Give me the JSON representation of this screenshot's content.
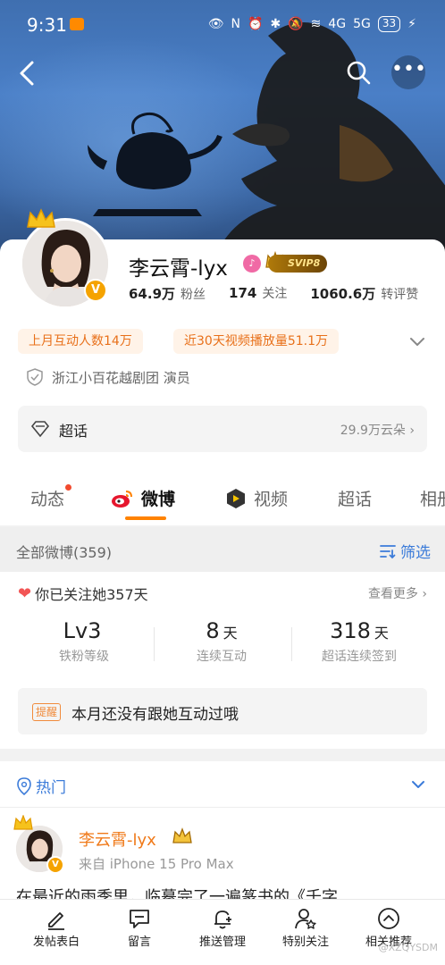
{
  "status_bar": {
    "time": "9:31",
    "network_1": "4G",
    "network_2": "5G",
    "battery": "33"
  },
  "profile": {
    "name": "李云霄-lyx",
    "svip_label": "SVIP8",
    "pink_badge": "♪",
    "v_badge": "V",
    "stats": [
      {
        "value": "64.9万",
        "label": "粉丝"
      },
      {
        "value": "174",
        "label": "关注"
      },
      {
        "value": "1060.6万",
        "label": "转评赞"
      }
    ],
    "tags": [
      "上月互动人数14万",
      "近30天视频播放量51.1万"
    ],
    "verification": "浙江小百花越剧团 演员"
  },
  "chaohua": {
    "label": "超话",
    "count": "29.9万云朵"
  },
  "tabs": [
    {
      "label": "动态"
    },
    {
      "label": "微博"
    },
    {
      "label": "视频"
    },
    {
      "label": "超话"
    },
    {
      "label": "相册"
    }
  ],
  "filter_bar": {
    "all_posts": "全部微博(359)",
    "filter_label": "筛选"
  },
  "fan_section": {
    "following_days": "你已关注她357天",
    "see_more": "查看更多",
    "metrics": [
      {
        "value": "Lv3",
        "unit": "",
        "label": "铁粉等级"
      },
      {
        "value": "8",
        "unit": "天",
        "label": "连续互动"
      },
      {
        "value": "318",
        "unit": "天",
        "label": "超话连续签到"
      }
    ],
    "reminder_tag": "提醒",
    "reminder_text": "本月还没有跟她互动过哦"
  },
  "hot": {
    "label": "热门"
  },
  "post": {
    "author": "李云霄-lyx",
    "source": "来自 iPhone 15 Pro Max",
    "text": "在最近的雨季里，临摹完了一遍篆书的《千字"
  },
  "toolbar": [
    {
      "label": "发帖表白",
      "icon": "pen-icon"
    },
    {
      "label": "留言",
      "icon": "comment-icon"
    },
    {
      "label": "推送管理",
      "icon": "bell-plus-icon"
    },
    {
      "label": "特别关注",
      "icon": "user-star-icon"
    },
    {
      "label": "相关推荐",
      "icon": "chevron-up-circle-icon"
    }
  ],
  "watermark": "@XZQYSDM",
  "colors": {
    "accent_orange": "#ff8200",
    "link_blue": "#3b7bd9",
    "tag_orange": "#e8701a"
  }
}
